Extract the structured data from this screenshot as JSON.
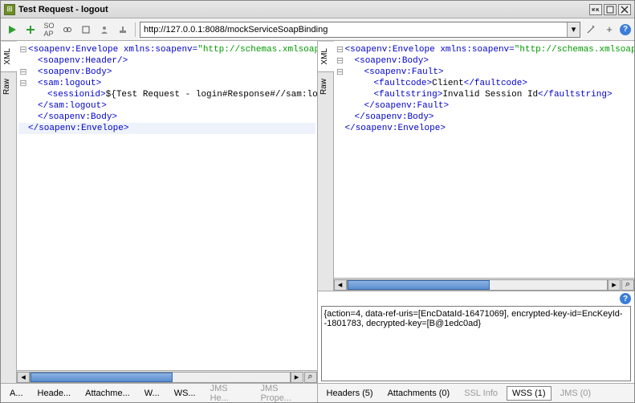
{
  "window": {
    "title": "Test Request - logout"
  },
  "toolbar": {
    "url": "http://127.0.0.1:8088/mockServiceSoapBinding"
  },
  "vtabs": {
    "xml": "XML",
    "raw": "Raw"
  },
  "request_xml": {
    "l1_open": "<soapenv:Envelope ",
    "l1_attr": "xmlns:soapenv",
    "l1_eq": "=",
    "l1_val": "\"http://schemas.xmlsoap.org/soap",
    "l2": "<soapenv:Header/>",
    "l3": "<soapenv:Body>",
    "l4": "<sam:logout>",
    "l5_open": "<sessionid>",
    "l5_text": "${Test Request - login#Response#//sam:loginResponse/s",
    "l6": "</sam:logout>",
    "l7": "</soapenv:Body>",
    "l8": "</soapenv:Envelope>"
  },
  "response_xml": {
    "l1_open": "<soapenv:Envelope ",
    "l1_attr": "xmlns:soapenv",
    "l1_eq": "=",
    "l1_val": "\"http://schemas.xmlsoap.org/so",
    "l2": "<soapenv:Body>",
    "l3": "<soapenv:Fault>",
    "l4_open": "<faultcode>",
    "l4_text": "Client",
    "l4_close": "</faultcode>",
    "l5_open": "<faultstring>",
    "l5_text": "Invalid Session Id",
    "l5_close": "</faultstring>",
    "l6": "</soapenv:Fault>",
    "l7": "</soapenv:Body>",
    "l8": "</soapenv:Envelope>"
  },
  "log": {
    "text": "{action=4, data-ref-uris=[EncDataId-16471069], encrypted-key-id=EncKeyId--1801783, decrypted-key=[B@1edc0ad}"
  },
  "left_tabs": {
    "a": "A...",
    "headers": "Heade...",
    "attachments": "Attachme...",
    "w": "W...",
    "ws": "WS...",
    "jms_he": "JMS He...",
    "jms_prope": "JMS Prope..."
  },
  "right_tabs": {
    "headers": "Headers (5)",
    "attachments": "Attachments (0)",
    "ssl": "SSL Info",
    "wss": "WSS (1)",
    "jms": "JMS (0)"
  }
}
